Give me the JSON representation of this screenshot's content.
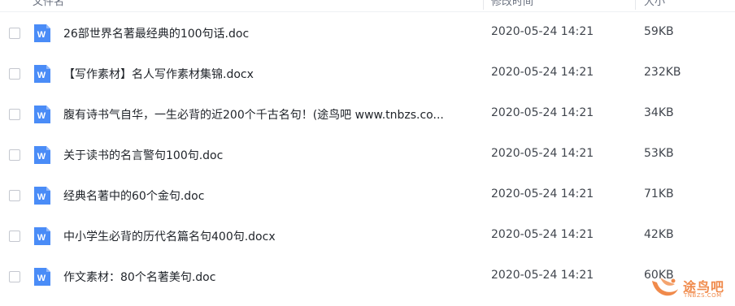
{
  "header": {
    "name_col": "文件名",
    "date_col": "修改时间",
    "size_col": "大小"
  },
  "icon": {
    "name": "word-doc-icon",
    "letter": "W",
    "color": "#4a8cf7"
  },
  "files": [
    {
      "name": "26部世界名著最经典的100句话.doc",
      "date": "2020-05-24 14:21",
      "size": "59KB"
    },
    {
      "name": "【写作素材】名人写作素材集锦.docx",
      "date": "2020-05-24 14:21",
      "size": "232KB"
    },
    {
      "name": "腹有诗书气自华，一生必背的近200个千古名句！(途鸟吧 www.tnbzs.co...",
      "date": "2020-05-24 14:21",
      "size": "34KB"
    },
    {
      "name": "关于读书的名言警句100句.doc",
      "date": "2020-05-24 14:21",
      "size": "53KB"
    },
    {
      "name": "经典名著中的60个金句.doc",
      "date": "2020-05-24 14:21",
      "size": "71KB"
    },
    {
      "name": "中小学生必背的历代名篇名句400句.docx",
      "date": "2020-05-24 14:21",
      "size": "42KB"
    },
    {
      "name": "作文素材：80个名著美句.doc",
      "date": "2020-05-24 14:21",
      "size": "60KB"
    }
  ],
  "watermark": {
    "text": "途鸟吧",
    "sub": "TNBZS.COM",
    "color": "#f08a4b"
  }
}
